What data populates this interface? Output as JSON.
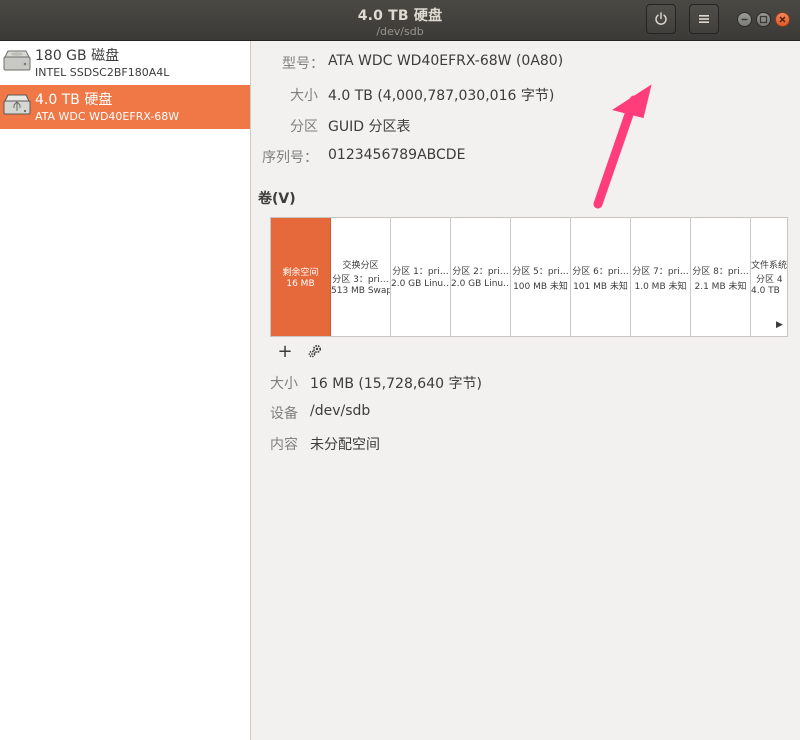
{
  "window": {
    "title": "4.0 TB 硬盘",
    "subtitle": "/dev/sdb"
  },
  "sidebar": {
    "drives": [
      {
        "name": "180 GB 磁盘",
        "model": "INTEL SSDSC2BF180A4L",
        "icon": "hard-disk-icon",
        "selected": false
      },
      {
        "name": "4.0 TB 硬盘",
        "model": "ATA WDC WD40EFRX-68W",
        "icon": "hard-disk-icon",
        "selected": true
      }
    ]
  },
  "drive_info": {
    "model_label": "型号",
    "model_value": "ATA WDC WD40EFRX-68W (0A80)",
    "size_label": "大小",
    "size_value": "4.0 TB (4,000,787,030,016 字节)",
    "partitioning_label": "分区",
    "partitioning_value": "GUID 分区表",
    "serial_label": "序列号",
    "serial_value": "0123456789ABCDE"
  },
  "volumes": {
    "heading": "卷(V)",
    "segments": [
      {
        "line1": "剩余空间",
        "line2": "16 MB",
        "selected": true
      },
      {
        "line1": "交换分区",
        "line2": "分区 3：pri…",
        "line3": "513 MB Swap"
      },
      {
        "line1": "分区 1：pri…",
        "line2": "2.0 GB Linu…"
      },
      {
        "line1": "分区 2：pri…",
        "line2": "2.0 GB Linu…"
      },
      {
        "line1": "分区 5：pri…",
        "line2": "100 MB 未知"
      },
      {
        "line1": "分区 6：pri…",
        "line2": "101 MB 未知"
      },
      {
        "line1": "分区 7：pri…",
        "line2": "1.0 MB 未知"
      },
      {
        "line1": "分区 8：pri…",
        "line2": "2.1 MB 未知"
      },
      {
        "line1": "文件系统",
        "line2": "分区 4",
        "line3": "4.0 TB"
      }
    ],
    "scroll_arrow": "▶",
    "add_label": "+"
  },
  "details": {
    "size_label": "大小",
    "size_value": "16 MB (15,728,640 字节)",
    "device_label": "设备",
    "device_value": "/dev/sdb",
    "contents_label": "内容",
    "contents_value": "未分配空间"
  },
  "colors": {
    "accent": "#f07746",
    "free_space": "#e5693a",
    "annotation_arrow": "#ff3d7a"
  }
}
